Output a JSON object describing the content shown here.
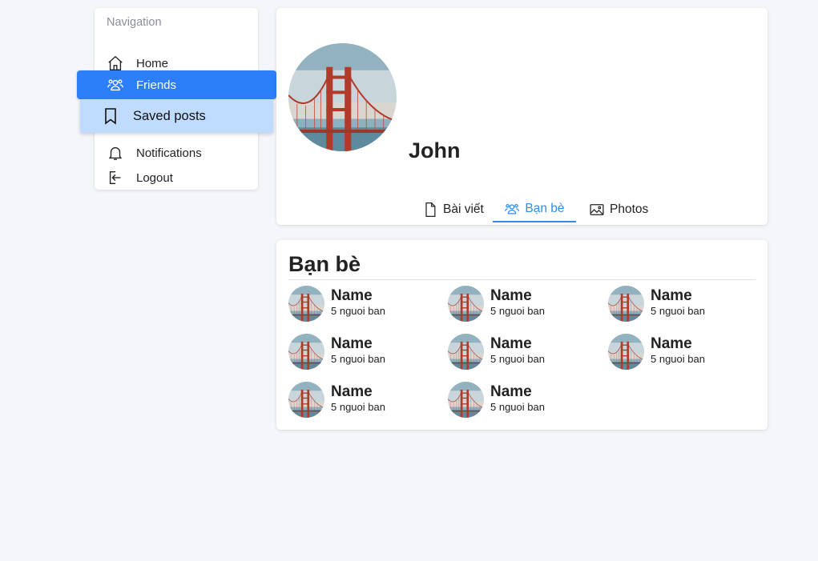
{
  "navigation": {
    "title": "Navigation",
    "items": [
      {
        "label": "Home",
        "icon": "home-icon"
      },
      {
        "label": "Friends",
        "icon": "users-icon",
        "active": true
      },
      {
        "label": "Saved posts",
        "icon": "bookmark-icon"
      },
      {
        "label": "Notifications",
        "icon": "bell-icon"
      },
      {
        "label": "Logout",
        "icon": "logout-icon"
      }
    ]
  },
  "profile": {
    "name": "John",
    "tabs": [
      {
        "label": "Bài viết",
        "icon": "file-icon"
      },
      {
        "label": "Bạn bè",
        "icon": "users-icon",
        "active": true
      },
      {
        "label": "Photos",
        "icon": "image-icon"
      }
    ]
  },
  "friends": {
    "title": "Bạn bè",
    "list": [
      {
        "name": "Name",
        "count": "5 nguoi ban"
      },
      {
        "name": "Name",
        "count": "5 nguoi ban"
      },
      {
        "name": "Name",
        "count": "5 nguoi ban"
      },
      {
        "name": "Name",
        "count": "5 nguoi ban"
      },
      {
        "name": "Name",
        "count": "5 nguoi ban"
      },
      {
        "name": "Name",
        "count": "5 nguoi ban"
      },
      {
        "name": "Name",
        "count": "5 nguoi ban"
      },
      {
        "name": "Name",
        "count": "5 nguoi ban"
      }
    ]
  },
  "colors": {
    "accent": "#2d7ff9",
    "tab_active": "#2d8cf0",
    "saved_highlight": "#bfdbfe",
    "background": "#f5f6fa"
  }
}
